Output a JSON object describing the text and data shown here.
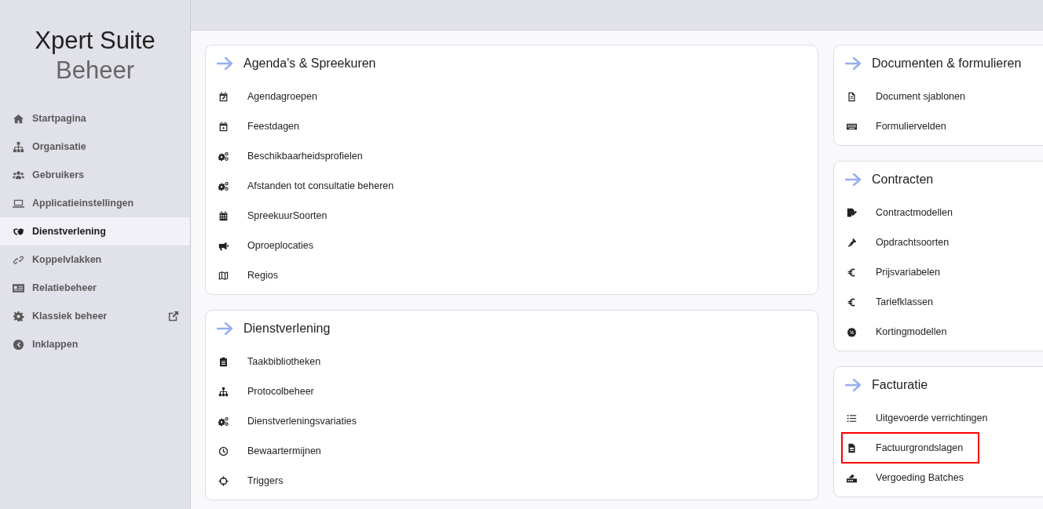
{
  "logo": {
    "line_1": "Xpert Suite",
    "line_2": "Beheer"
  },
  "sidebar": {
    "items": [
      {
        "label": "Startpagina",
        "selected": false
      },
      {
        "label": "Organisatie",
        "selected": false
      },
      {
        "label": "Gebruikers",
        "selected": false
      },
      {
        "label": "Applicatieinstellingen",
        "selected": false
      },
      {
        "label": "Dienstverlening",
        "selected": true
      },
      {
        "label": "Koppelvlakken",
        "selected": false
      },
      {
        "label": "Relatiebeheer",
        "selected": false
      },
      {
        "label": "Klassiek beheer",
        "selected": false,
        "external": true
      },
      {
        "label": "Inklappen",
        "selected": false
      }
    ]
  },
  "columns": [
    {
      "cards": [
        {
          "title": "Agenda's & Spreekuren",
          "items": [
            {
              "label": "Agendagroepen",
              "highlighted": false
            },
            {
              "label": "Feestdagen",
              "highlighted": false
            },
            {
              "label": "Beschikbaarheidsprofielen",
              "highlighted": false
            },
            {
              "label": "Afstanden tot consultatie beheren",
              "highlighted": false
            },
            {
              "label": "SpreekuurSoorten",
              "highlighted": false
            },
            {
              "label": "Oproeplocaties",
              "highlighted": false
            },
            {
              "label": "Regios",
              "highlighted": false
            }
          ]
        },
        {
          "title": "Dienstverlening",
          "items": [
            {
              "label": "Taakbibliotheken",
              "highlighted": false
            },
            {
              "label": "Protocolbeheer",
              "highlighted": false
            },
            {
              "label": "Dienstverleningsvariaties",
              "highlighted": false
            },
            {
              "label": "Bewaartermijnen",
              "highlighted": false
            },
            {
              "label": "Triggers",
              "highlighted": false
            }
          ]
        }
      ]
    },
    {
      "cards": [
        {
          "title": "Documenten & formulieren",
          "items": [
            {
              "label": "Document sjablonen",
              "highlighted": false
            },
            {
              "label": "Formuliervelden",
              "highlighted": false
            }
          ]
        },
        {
          "title": "Contracten",
          "items": [
            {
              "label": "Contractmodellen",
              "highlighted": false
            },
            {
              "label": "Opdrachtsoorten",
              "highlighted": false
            },
            {
              "label": "Prijsvariabelen",
              "highlighted": false
            },
            {
              "label": "Tariefklassen",
              "highlighted": false
            },
            {
              "label": "Kortingmodellen",
              "highlighted": false
            }
          ]
        },
        {
          "title": "Facturatie",
          "items": [
            {
              "label": "Uitgevoerde verrichtingen",
              "highlighted": false
            },
            {
              "label": "Factuurgrondslagen",
              "highlighted": true
            },
            {
              "label": "Vergoeding Batches",
              "highlighted": false
            }
          ]
        }
      ]
    }
  ]
}
